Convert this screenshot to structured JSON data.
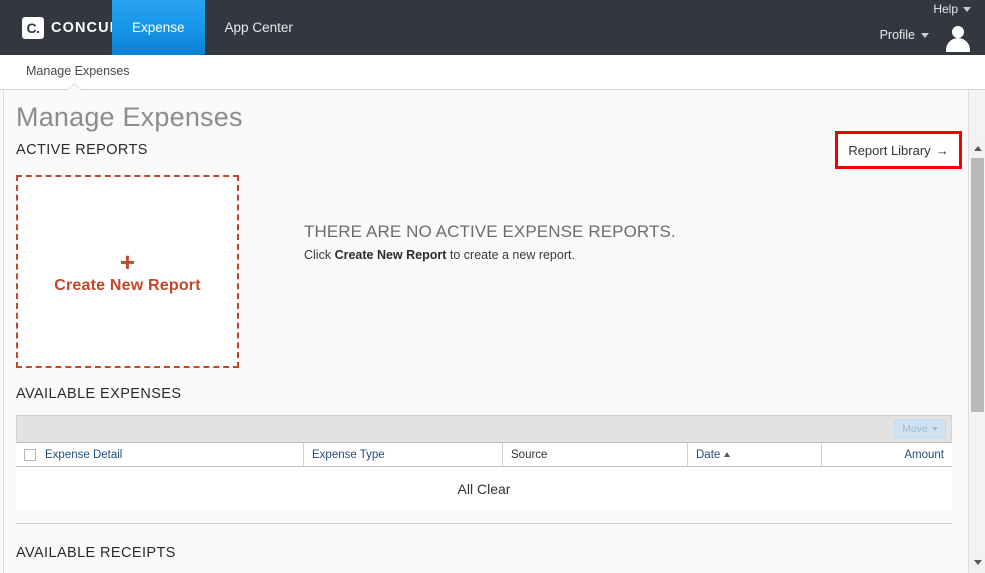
{
  "topnav": {
    "logo_mark": "C.",
    "logo_text": "CONCUR",
    "tabs": [
      {
        "label": "Expense",
        "active": true
      },
      {
        "label": "App Center",
        "active": false
      }
    ],
    "help_label": "Help",
    "profile_label": "Profile",
    "avatar_icon": "user-avatar-icon",
    "background_color": "#333840",
    "active_tab_color": "#1796e8"
  },
  "subnav": {
    "items": [
      {
        "label": "Manage Expenses"
      }
    ]
  },
  "page": {
    "title": "Manage Expenses"
  },
  "active_reports": {
    "section_label": "ACTIVE REPORTS",
    "report_library_label": "Report Library",
    "report_library_arrow": "→",
    "highlight_color": "#ee0000",
    "create_tile": {
      "plus_icon": "+",
      "label": "Create New Report",
      "accent_color": "#c0472a"
    },
    "empty_state": {
      "headline": "THERE ARE NO ACTIVE EXPENSE REPORTS.",
      "sub_prefix": "Click ",
      "sub_bold": "Create New Report",
      "sub_suffix": " to create a new report."
    }
  },
  "available_expenses": {
    "section_label": "AVAILABLE EXPENSES",
    "toolbar": {
      "move_label": "Move",
      "move_enabled": false
    },
    "columns": [
      {
        "label": "Expense Detail",
        "sort": ""
      },
      {
        "label": "Expense Type",
        "sort": ""
      },
      {
        "label": "Source",
        "sort": ""
      },
      {
        "label": "Date",
        "sort": "asc"
      },
      {
        "label": "Amount",
        "sort": ""
      }
    ],
    "rows": [],
    "empty_text": "All Clear"
  },
  "available_receipts": {
    "section_label": "AVAILABLE RECEIPTS"
  },
  "scrollbar": {
    "up_icon": "scroll-up-icon",
    "down_icon": "scroll-down-icon",
    "thumb_top_pct": 14,
    "thumb_height_pct": 53
  }
}
